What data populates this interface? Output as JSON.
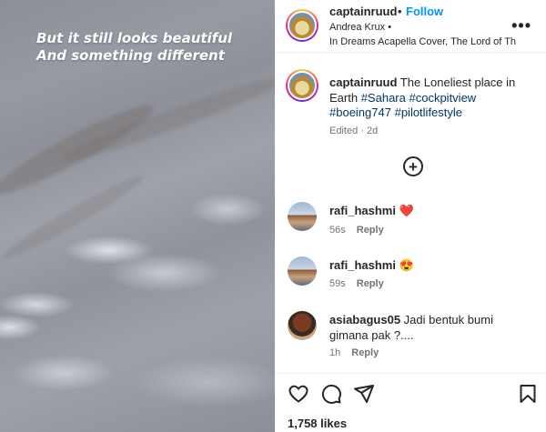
{
  "media": {
    "overlay_line1": "But it still looks beautiful",
    "overlay_line2": "And something different"
  },
  "header": {
    "username": "captainruud",
    "separator": "•",
    "follow_label": "Follow",
    "audio_artist": "Andrea Krux •",
    "audio_title": "In Dreams Acapella Cover, The Lord of Th",
    "more_icon": "more-horizontal-icon",
    "more_glyph": "•••"
  },
  "caption": {
    "username": "captainruud",
    "text": "The Loneliest place in Earth",
    "hashtags": [
      "#Sahara",
      "#cockpitview",
      "#boeing747",
      "#pilotlifestyle"
    ],
    "meta": "Edited · 2d"
  },
  "load_more": {
    "icon": "plus-circle-icon",
    "glyph": "+"
  },
  "comments": [
    {
      "username": "rafi_hashmi",
      "text": "❤️",
      "time": "56s",
      "reply_label": "Reply"
    },
    {
      "username": "rafi_hashmi",
      "text": "😍",
      "time": "59s",
      "reply_label": "Reply"
    },
    {
      "username": "asiabagus05",
      "text": "Jadi bentuk bumi gimana pak ?....",
      "time": "1h",
      "reply_label": "Reply"
    }
  ],
  "actions": {
    "like_icon": "heart-icon",
    "comment_icon": "comment-icon",
    "share_icon": "send-icon",
    "save_icon": "bookmark-icon"
  },
  "likes": "1,758 likes",
  "colors": {
    "link_blue": "#0095f6",
    "hashtag": "#00376b",
    "heart_red": "#ed4956",
    "muted": "#737373"
  }
}
